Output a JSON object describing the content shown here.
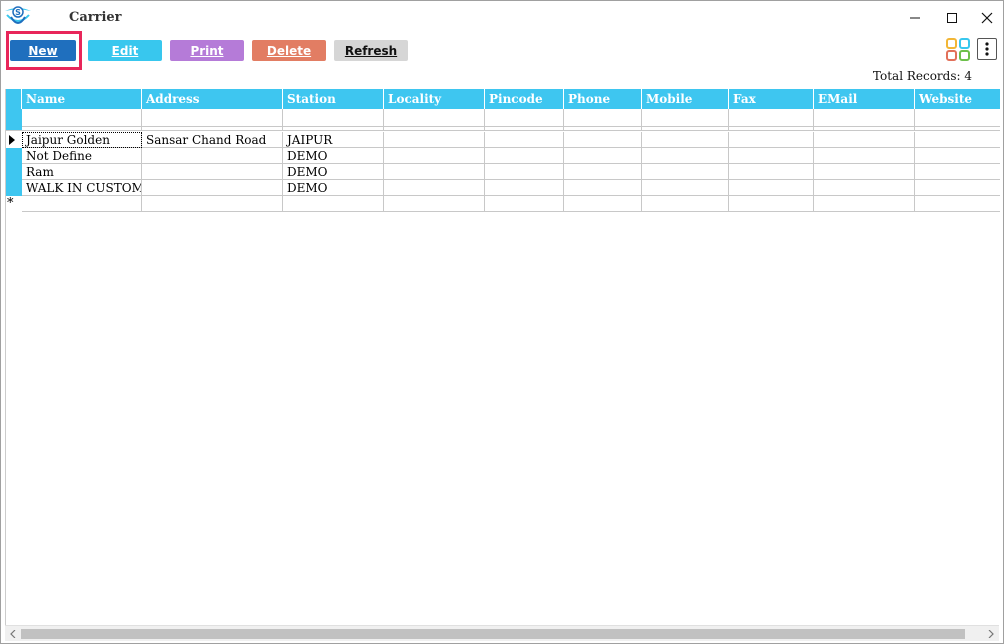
{
  "window": {
    "title": "Carrier"
  },
  "toolbar": {
    "new_label": "New",
    "edit_label": "Edit",
    "print_label": "Print",
    "delete_label": "Delete",
    "refresh_label": "Refresh",
    "colors": {
      "new": "#1f6fbe",
      "edit": "#38c7ee",
      "print": "#b57bd8",
      "delete": "#e27d63",
      "refresh": "#d6d6d6",
      "highlight": "#e8265a"
    }
  },
  "status": {
    "total_records": "Total Records: 4"
  },
  "grid": {
    "header_color": "#3ec6f0",
    "columns": [
      "Name",
      "Address",
      "Station",
      "Locality",
      "Pincode",
      "Phone",
      "Mobile",
      "Fax",
      "EMail",
      "Website"
    ],
    "rows": [
      [
        "Jaipur Golden",
        "Sansar Chand Road",
        "JAIPUR",
        "",
        "",
        "",
        "",
        "",
        "",
        ""
      ],
      [
        "Not Define",
        "",
        "DEMO",
        "",
        "",
        "",
        "",
        "",
        "",
        ""
      ],
      [
        "Ram",
        "",
        "DEMO",
        "",
        "",
        "",
        "",
        "",
        "",
        ""
      ],
      [
        "WALK IN CUSTOMER",
        "",
        "DEMO",
        "",
        "",
        "",
        "",
        "",
        "",
        ""
      ]
    ],
    "new_row_marker": "*"
  },
  "icons": {
    "app_logo": "app-logo",
    "minimize": "minimize-icon",
    "maximize": "maximize-icon",
    "close": "close-icon",
    "layout": "grid-layout-icon",
    "more": "more-vertical-icon",
    "current_row": "current-row-arrow-icon"
  }
}
